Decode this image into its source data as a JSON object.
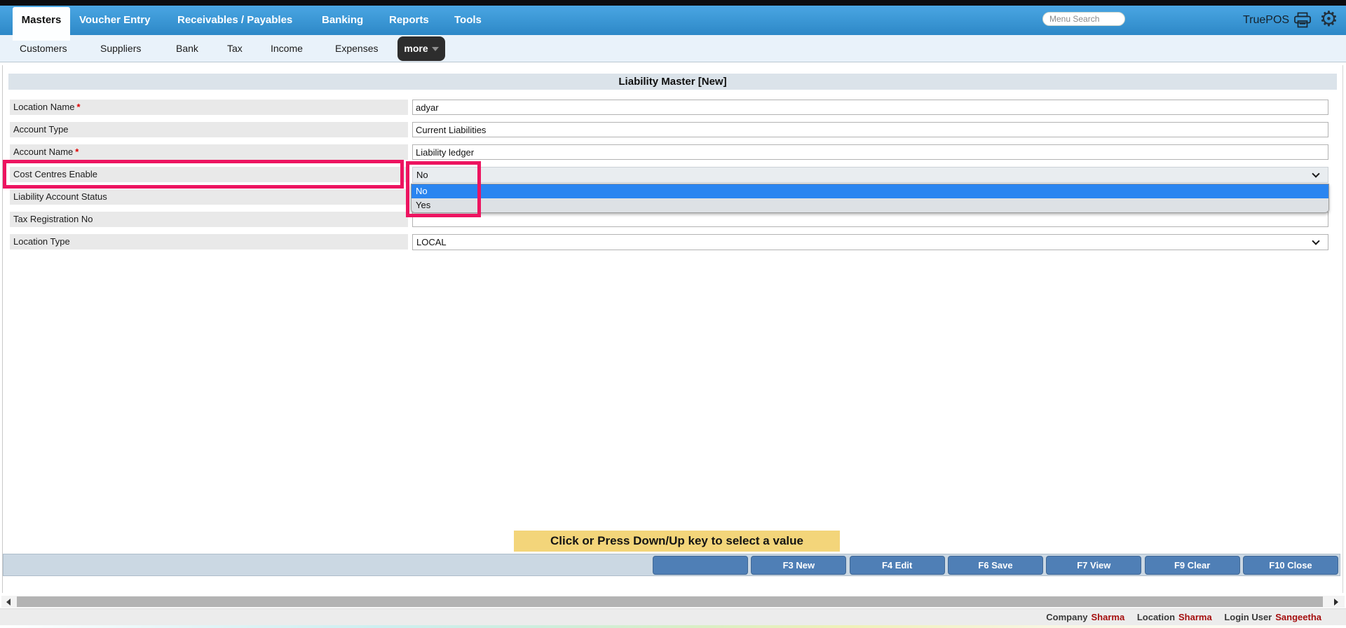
{
  "nav": {
    "tabs": [
      {
        "label": "Masters",
        "active": true
      },
      {
        "label": "Voucher Entry",
        "active": false
      },
      {
        "label": "Receivables / Payables",
        "active": false
      },
      {
        "label": "Banking",
        "active": false
      },
      {
        "label": "Reports",
        "active": false
      },
      {
        "label": "Tools",
        "active": false
      }
    ],
    "menu_search_placeholder": "Menu Search",
    "brand": "TruePOS"
  },
  "subnav": {
    "items": [
      "Customers",
      "Suppliers",
      "Bank",
      "Tax",
      "Income",
      "Expenses"
    ],
    "more_label": "more"
  },
  "page": {
    "title": "Liability Master [New]"
  },
  "form": {
    "rows": [
      {
        "label": "Location Name",
        "req": "*",
        "value": "adyar",
        "type": "text"
      },
      {
        "label": "Account Type",
        "req": "",
        "value": "Current Liabilities",
        "type": "text"
      },
      {
        "label": "Account Name",
        "req": "*",
        "value": "Liability ledger",
        "type": "text"
      },
      {
        "label": "Cost Centres Enable",
        "req": "",
        "value": "No",
        "type": "select"
      },
      {
        "label": "Liability Account Status",
        "req": "",
        "value": "",
        "type": "text"
      },
      {
        "label": "Tax Registration No",
        "req": "",
        "value": "",
        "type": "text"
      },
      {
        "label": "Location Type",
        "req": "",
        "value": "LOCAL",
        "type": "select"
      }
    ]
  },
  "dropdown": {
    "options": [
      {
        "label": "No",
        "selected": true
      },
      {
        "label": "Yes",
        "selected": false
      }
    ]
  },
  "tooltip": {
    "text": "Click or Press Down/Up key to select a value"
  },
  "toolbar": {
    "buttons": [
      "",
      "F3 New",
      "F4 Edit",
      "F6 Save",
      "F7 View",
      "F9 Clear",
      "F10 Close"
    ]
  },
  "footer": {
    "segments": [
      {
        "label": "Company",
        "value": "Sharma"
      },
      {
        "label": "Location",
        "value": "Sharma"
      },
      {
        "label": "Login User",
        "value": "Sangeetha"
      }
    ]
  },
  "colors": {
    "annotation_pink": "#ed1460",
    "option_selected_blue": "#2a85f0",
    "button_blue": "#4f7fb6",
    "tooltip_yellow": "#f3d57a",
    "nav_blue": "#3a97d6",
    "footer_value_red": "#a50f0f"
  }
}
